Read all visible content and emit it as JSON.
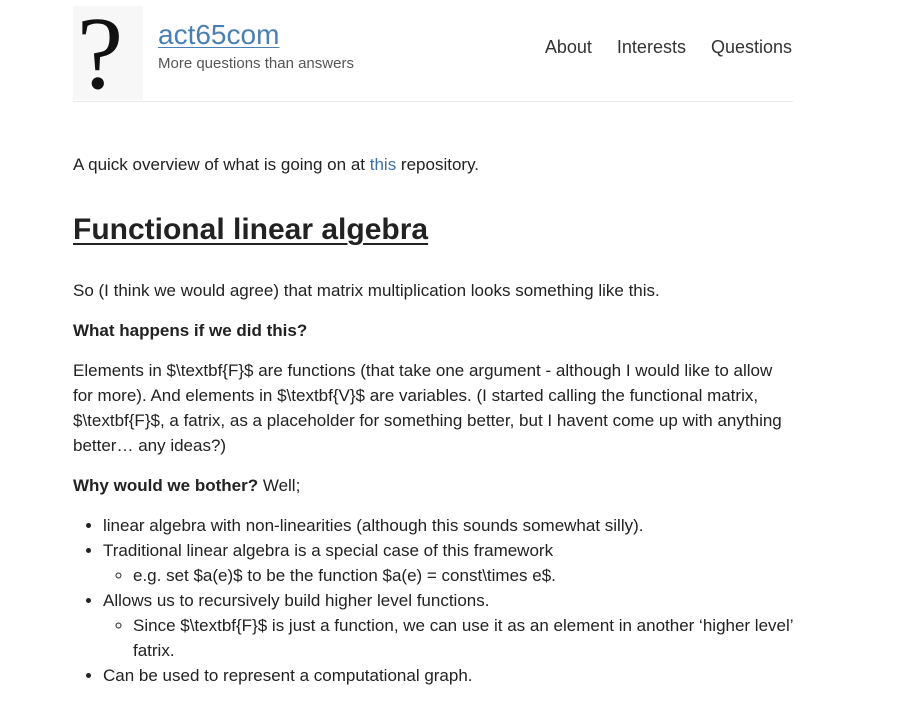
{
  "site": {
    "logo_glyph": "?",
    "title": "act65com",
    "tagline": "More questions than answers"
  },
  "nav": {
    "about": "About",
    "interests": "Interests",
    "questions": "Questions"
  },
  "post": {
    "intro_prefix": "A quick overview of what is going on at ",
    "intro_link": "this",
    "intro_suffix": " repository.",
    "heading": "Functional linear algebra",
    "p1": "So (I think we would agree) that matrix multiplication looks something like this.",
    "q1": "What happens if we did this?",
    "p2": "Elements in $\\textbf{F}$ are functions (that take one argument - although I would like to allow for more). And elements in $\\textbf{V}$ are variables. (I started calling the functional matrix, $\\textbf{F}$, a fatrix, as a placeholder for something better, but I havent come up with anything better… any ideas?)",
    "q2_bold": "Why would we bother?",
    "q2_rest": " Well;",
    "bullets": {
      "b1": "linear algebra with non-linearities (although this sounds somewhat silly).",
      "b2": "Traditional linear algebra is a special case of this framework",
      "b2_sub1": "e.g. set $a(e)$ to be the function $a(e) = const\\times e$.",
      "b3": "Allows us to recursively build higher level functions.",
      "b3_sub1": "Since $\\textbf{F}$ is just a function, we can use it as an element in another ‘higher level’ fatrix.",
      "b4": "Can be used to represent a computational graph."
    }
  },
  "colors": {
    "link": "#3d6fa8",
    "title_link": "#4a7fb5",
    "text": "#222222"
  }
}
